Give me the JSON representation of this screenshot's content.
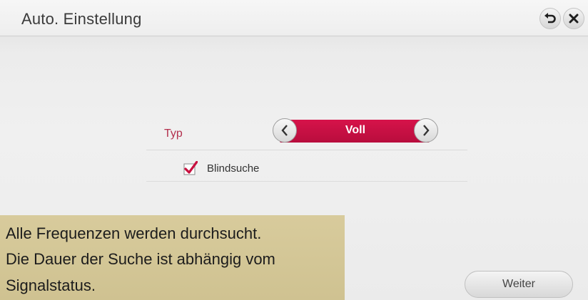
{
  "window": {
    "title": "Auto. Einstellung"
  },
  "header": {
    "back_icon": "back-arrow-icon",
    "close_icon": "close-icon"
  },
  "settings": {
    "type_label": "Typ",
    "type_value": "Voll",
    "blind_search_label": "Blindsuche",
    "blind_search_checked": true
  },
  "tooltip": {
    "line1": "Alle Frequenzen werden durchsucht.",
    "line2": "Die Dauer der Suche ist abhängig vom",
    "line3": "Signalstatus."
  },
  "footer": {
    "next_label": "Weiter"
  },
  "colors": {
    "accent": "#c8103f",
    "label_accent": "#b3304d",
    "tooltip_bg": "#d4c797"
  }
}
